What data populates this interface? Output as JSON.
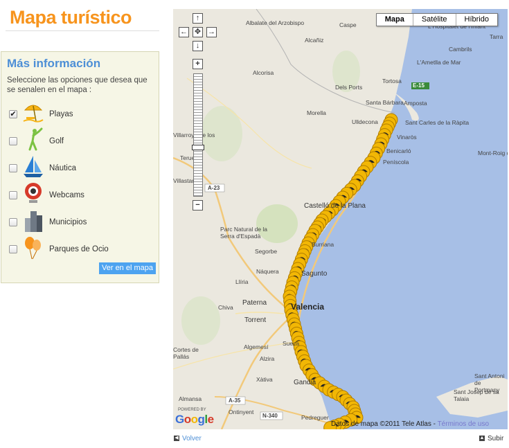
{
  "page": {
    "title": "Mapa turístico"
  },
  "panel": {
    "heading": "Más información",
    "description": "Seleccione las opciones que desea que se senalen en el mapa :",
    "options": [
      {
        "label": "Playas",
        "checked": true,
        "icon": "beach-umbrella-icon"
      },
      {
        "label": "Golf",
        "checked": false,
        "icon": "golfer-icon"
      },
      {
        "label": "Náutica",
        "checked": false,
        "icon": "sailboat-icon"
      },
      {
        "label": "Webcams",
        "checked": false,
        "icon": "webcam-icon"
      },
      {
        "label": "Municipios",
        "checked": false,
        "icon": "buildings-icon"
      },
      {
        "label": "Parques de Ocio",
        "checked": false,
        "icon": "balloons-icon"
      }
    ],
    "button": "Ver en el mapa"
  },
  "map": {
    "types": [
      "Mapa",
      "Satélite",
      "Híbrido"
    ],
    "selected_type": "Mapa",
    "zoom_in": "+",
    "zoom_out": "−",
    "labels": {
      "albalate": "Albalate del Arzobispo",
      "caspe": "Caspe",
      "hospitalet": "L'Hospitalet de l'Infant",
      "alcaniz": "Alcañiz",
      "cambrils": "Cambrils",
      "tarra": "Tarra",
      "ametlla": "L'Ametlla de Mar",
      "alcorisa": "Alcorisa",
      "tortosa": "Tortosa",
      "delsports": "Dels Ports",
      "amposta": "Amposta",
      "santabarbara": "Santa Bárbara",
      "morella": "Morella",
      "ulldecona": "Ulldecona",
      "santcarles": "Sant Carles de la Ràpita",
      "vinaros": "Vinaròs",
      "benicarlo": "Benicarló",
      "montroig": "Mont-Roig del Camp",
      "peniscola": "Peníscola",
      "villarroya": "Villarroya de los Pinares",
      "teruel": "Teruel",
      "villastar": "Villastar",
      "castellon": "Castelló de la Plana",
      "parque": "Parc Natural de la Serra d'Espadà",
      "segorbe": "Segorbe",
      "burriana": "Burriana",
      "naquera": "Náquera",
      "sagunto": "Sagunto",
      "lliria": "Llíria",
      "paterna": "Paterna",
      "chiva": "Chiva",
      "valencia": "Valencia",
      "torrent": "Torrent",
      "sueca": "Sueca",
      "algemesi": "Algemesí",
      "alzira": "Alzira",
      "cortes": "Cortes de Pallás",
      "xativa": "Xàtiva",
      "gandia": "Gandia",
      "almansa": "Almansa",
      "ontinyent": "Ontinyent",
      "pedreguer": "Pedreguer",
      "santantoni": "Sant Antoni de Portmany",
      "santjosep": "Sant Josep de sa Talaia",
      "a23": "A-23",
      "a35": "A-35",
      "n340": "N-340",
      "e15": "E-15"
    },
    "powered_by": "POWERED BY",
    "logo": "Google",
    "copyright": "Datos de mapa ©2011 Tele Atlas - ",
    "terms": "Términos de uso"
  },
  "footer": {
    "back": "Volver",
    "up": "Subir"
  },
  "colors": {
    "title": "#f7941d",
    "heading": "#4d8fd6",
    "marker": "#f2b705",
    "sea": "#a7bfe6",
    "button": "#4da3f0"
  }
}
